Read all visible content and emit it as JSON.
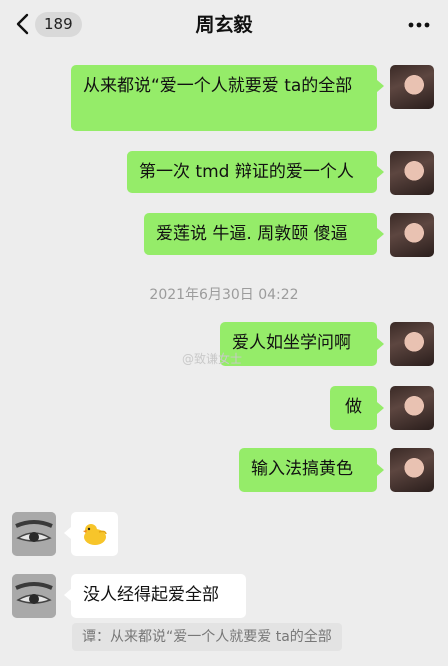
{
  "header": {
    "back_count": "189",
    "title": "周玄毅"
  },
  "messages": [
    {
      "sender": "me",
      "text": "从来都说“爱一个人就要爱 ta的全部"
    },
    {
      "sender": "me",
      "text": "第一次 tmd 辩证的爱一个人"
    },
    {
      "sender": "me",
      "text": "爱莲说 牛逼. 周敦颐 傻逼"
    },
    {
      "sender": "me",
      "text": "爱人如坐学问啊"
    },
    {
      "sender": "me",
      "text": "做"
    },
    {
      "sender": "me",
      "text": "输入法搞黄色"
    },
    {
      "sender": "other",
      "sticker": "duck-emoji"
    },
    {
      "sender": "other",
      "text": "没人经得起爱全部"
    }
  ],
  "timestamp": "2021年6月30日 04:22",
  "watermark": "@致谦女士",
  "quote": "谭：从来都说“爱一个人就要爱 ta的全部",
  "colors": {
    "background": "#ededed",
    "my_bubble": "#95ec69",
    "other_bubble": "#ffffff"
  }
}
